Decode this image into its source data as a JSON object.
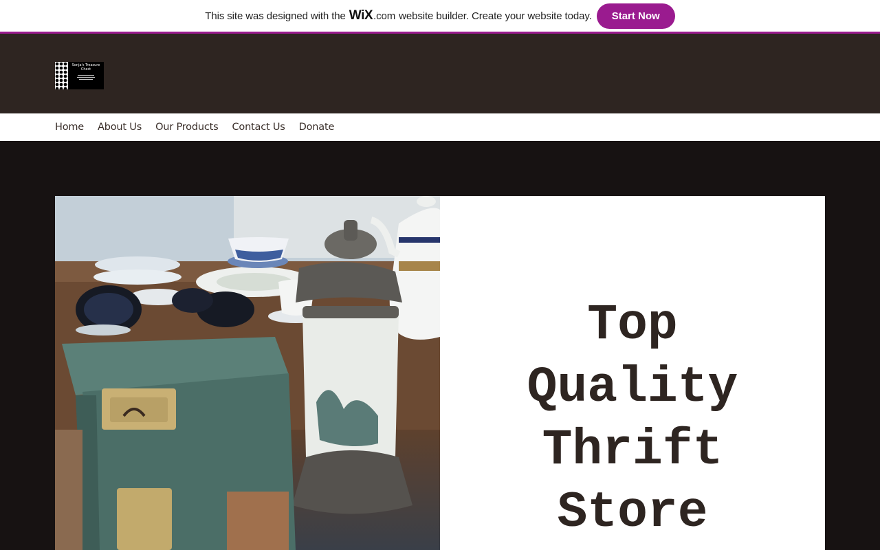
{
  "banner": {
    "text_before": "This site was designed with the",
    "logo": "WiX",
    "dotcom": ".com",
    "text_after": "website builder. Create your website today.",
    "button_label": "Start Now",
    "accent_color": "#9a1b8f"
  },
  "header": {
    "logo_name": "Sonja's Treasure Chest",
    "background_color": "#2e2521"
  },
  "nav": {
    "items": [
      {
        "label": "Home"
      },
      {
        "label": "About Us"
      },
      {
        "label": "Our Products"
      },
      {
        "label": "Contact Us"
      },
      {
        "label": "Donate"
      }
    ]
  },
  "hero": {
    "title": "Top Quality Thrift Store"
  }
}
